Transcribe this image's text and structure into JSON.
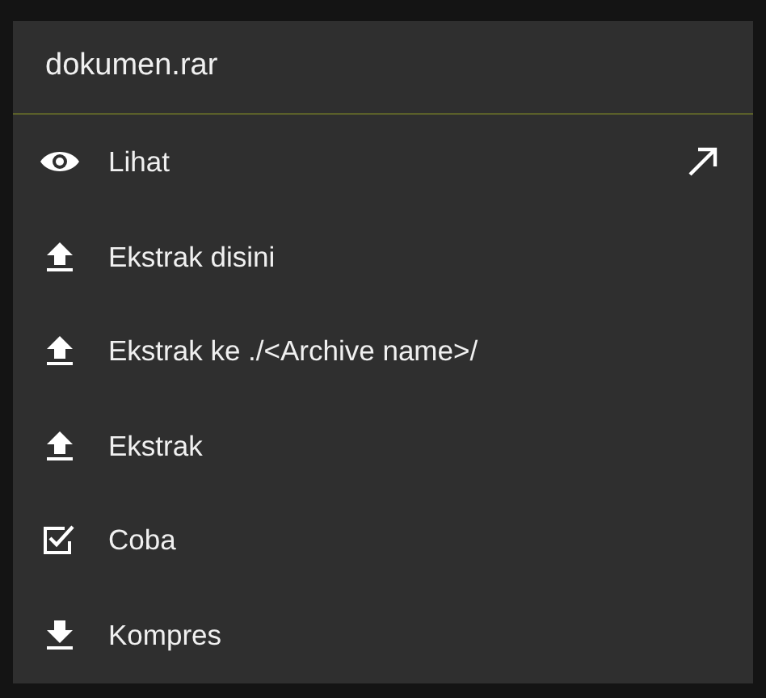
{
  "dialog": {
    "title": "dokumen.rar",
    "items": [
      {
        "kind": "view",
        "label": "Lihat",
        "trailing_arrow": true
      },
      {
        "kind": "extract",
        "label": "Ekstrak disini",
        "trailing_arrow": false
      },
      {
        "kind": "extract",
        "label": "Ekstrak ke ./<Archive name>/",
        "trailing_arrow": false
      },
      {
        "kind": "extract",
        "label": "Ekstrak",
        "trailing_arrow": false
      },
      {
        "kind": "test",
        "label": "Coba",
        "trailing_arrow": false
      },
      {
        "kind": "compress",
        "label": "Kompres",
        "trailing_arrow": false
      }
    ]
  }
}
